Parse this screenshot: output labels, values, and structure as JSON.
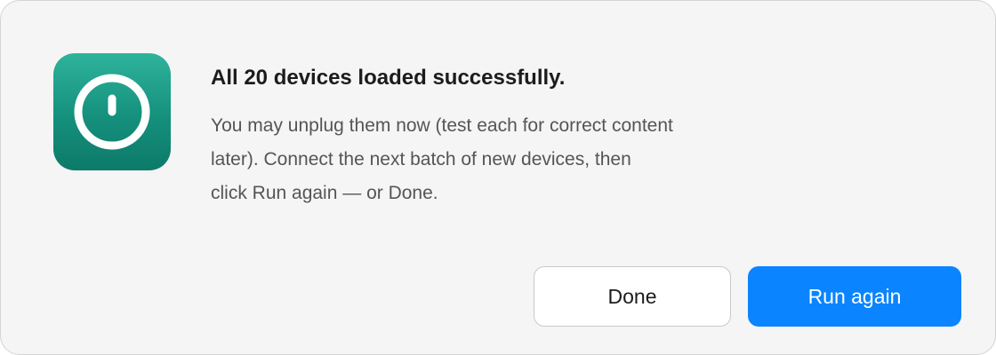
{
  "dialog": {
    "icon": "power-icon",
    "accent_color": "#0a84ff",
    "icon_color": "#159a86",
    "title": "All 20 devices loaded successfully.",
    "message_lines": [
      "You may unplug them now (test each for correct content",
      "later). Connect the next batch of new devices, then",
      "click Run again — or Done."
    ],
    "buttons": {
      "done": "Done",
      "run_again": "Run again"
    }
  }
}
